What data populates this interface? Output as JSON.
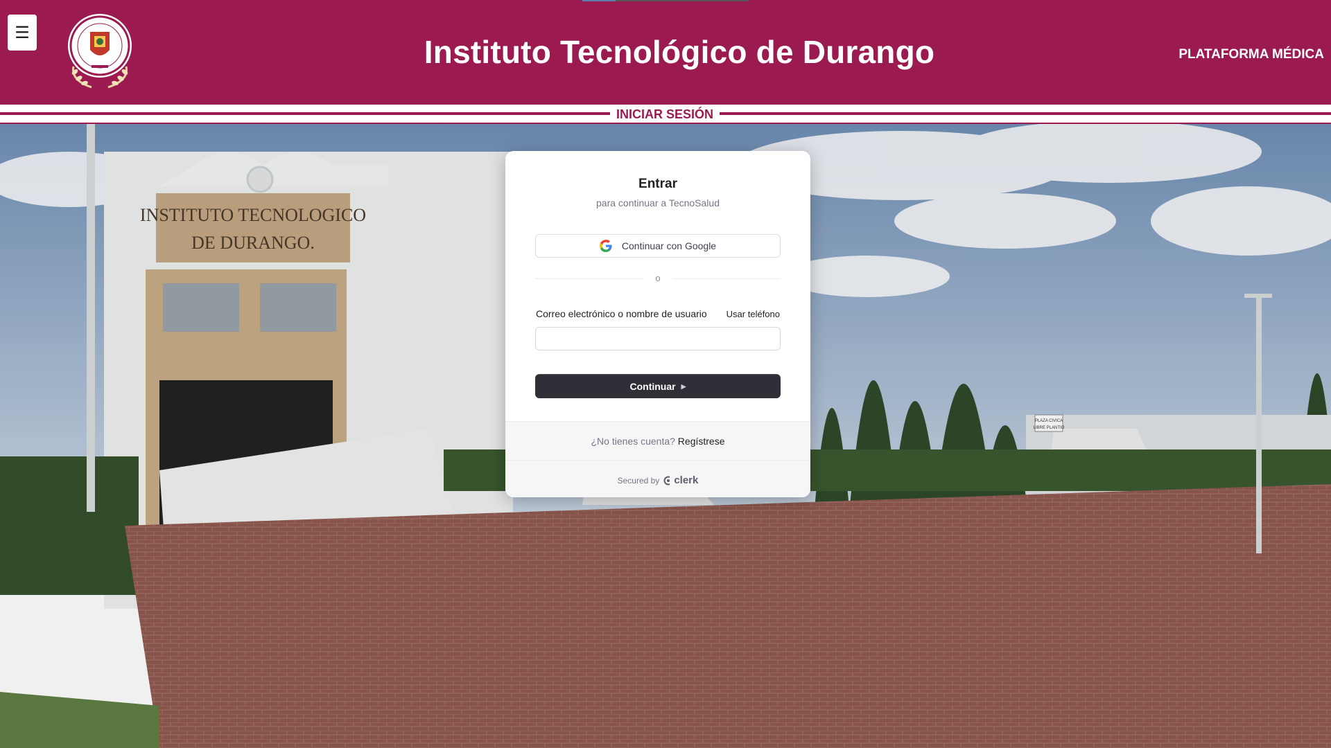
{
  "header": {
    "title": "Instituto Tecnológico de Durango",
    "platform_label": "PLATAFORMA MÉDICA",
    "menu_icon": "☰",
    "brand_color": "#9b1a4f"
  },
  "section": {
    "label": "INICIAR SESIÓN"
  },
  "background": {
    "building_sign_line1": "INSTITUTO TECNOLOGICO",
    "building_sign_line2": "DE DURANGO.",
    "plaza_sign_line1": "PLAZA CIVICA",
    "plaza_sign_line2": "LIBRE PLANTIO"
  },
  "login": {
    "title": "Entrar",
    "subtitle": "para continuar a TecnoSalud",
    "google_button": "Continuar con Google",
    "divider_text": "o",
    "email_label": "Correo electrónico o nombre de usuario",
    "use_phone": "Usar teléfono",
    "email_value": "",
    "continue_button": "Continuar",
    "no_account": "¿No tienes cuenta?",
    "signup_link": "Regístrese",
    "secured_by": "Secured by",
    "secured_brand": "clerk"
  }
}
